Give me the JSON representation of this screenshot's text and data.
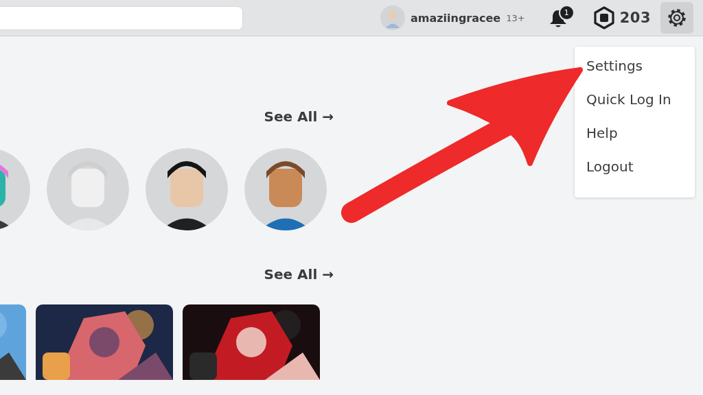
{
  "user": {
    "name": "amaziingracee",
    "age_badge": "13+"
  },
  "notifications": {
    "count": "1"
  },
  "robux": {
    "amount": "203"
  },
  "settings_button": {
    "selected": true
  },
  "sections": [
    {
      "kind": "friends",
      "see_all": "See All →",
      "items": [
        {
          "kind": "avatar"
        },
        {
          "kind": "avatar"
        },
        {
          "kind": "avatar"
        },
        {
          "kind": "avatar"
        }
      ]
    },
    {
      "kind": "games",
      "see_all": "See All →"
    }
  ],
  "menu": {
    "items": [
      {
        "label": "Settings"
      },
      {
        "label": "Quick Log In"
      },
      {
        "label": "Help"
      },
      {
        "label": "Logout"
      }
    ]
  },
  "annotation": {
    "kind": "arrow",
    "color": "#ee2a2a"
  }
}
